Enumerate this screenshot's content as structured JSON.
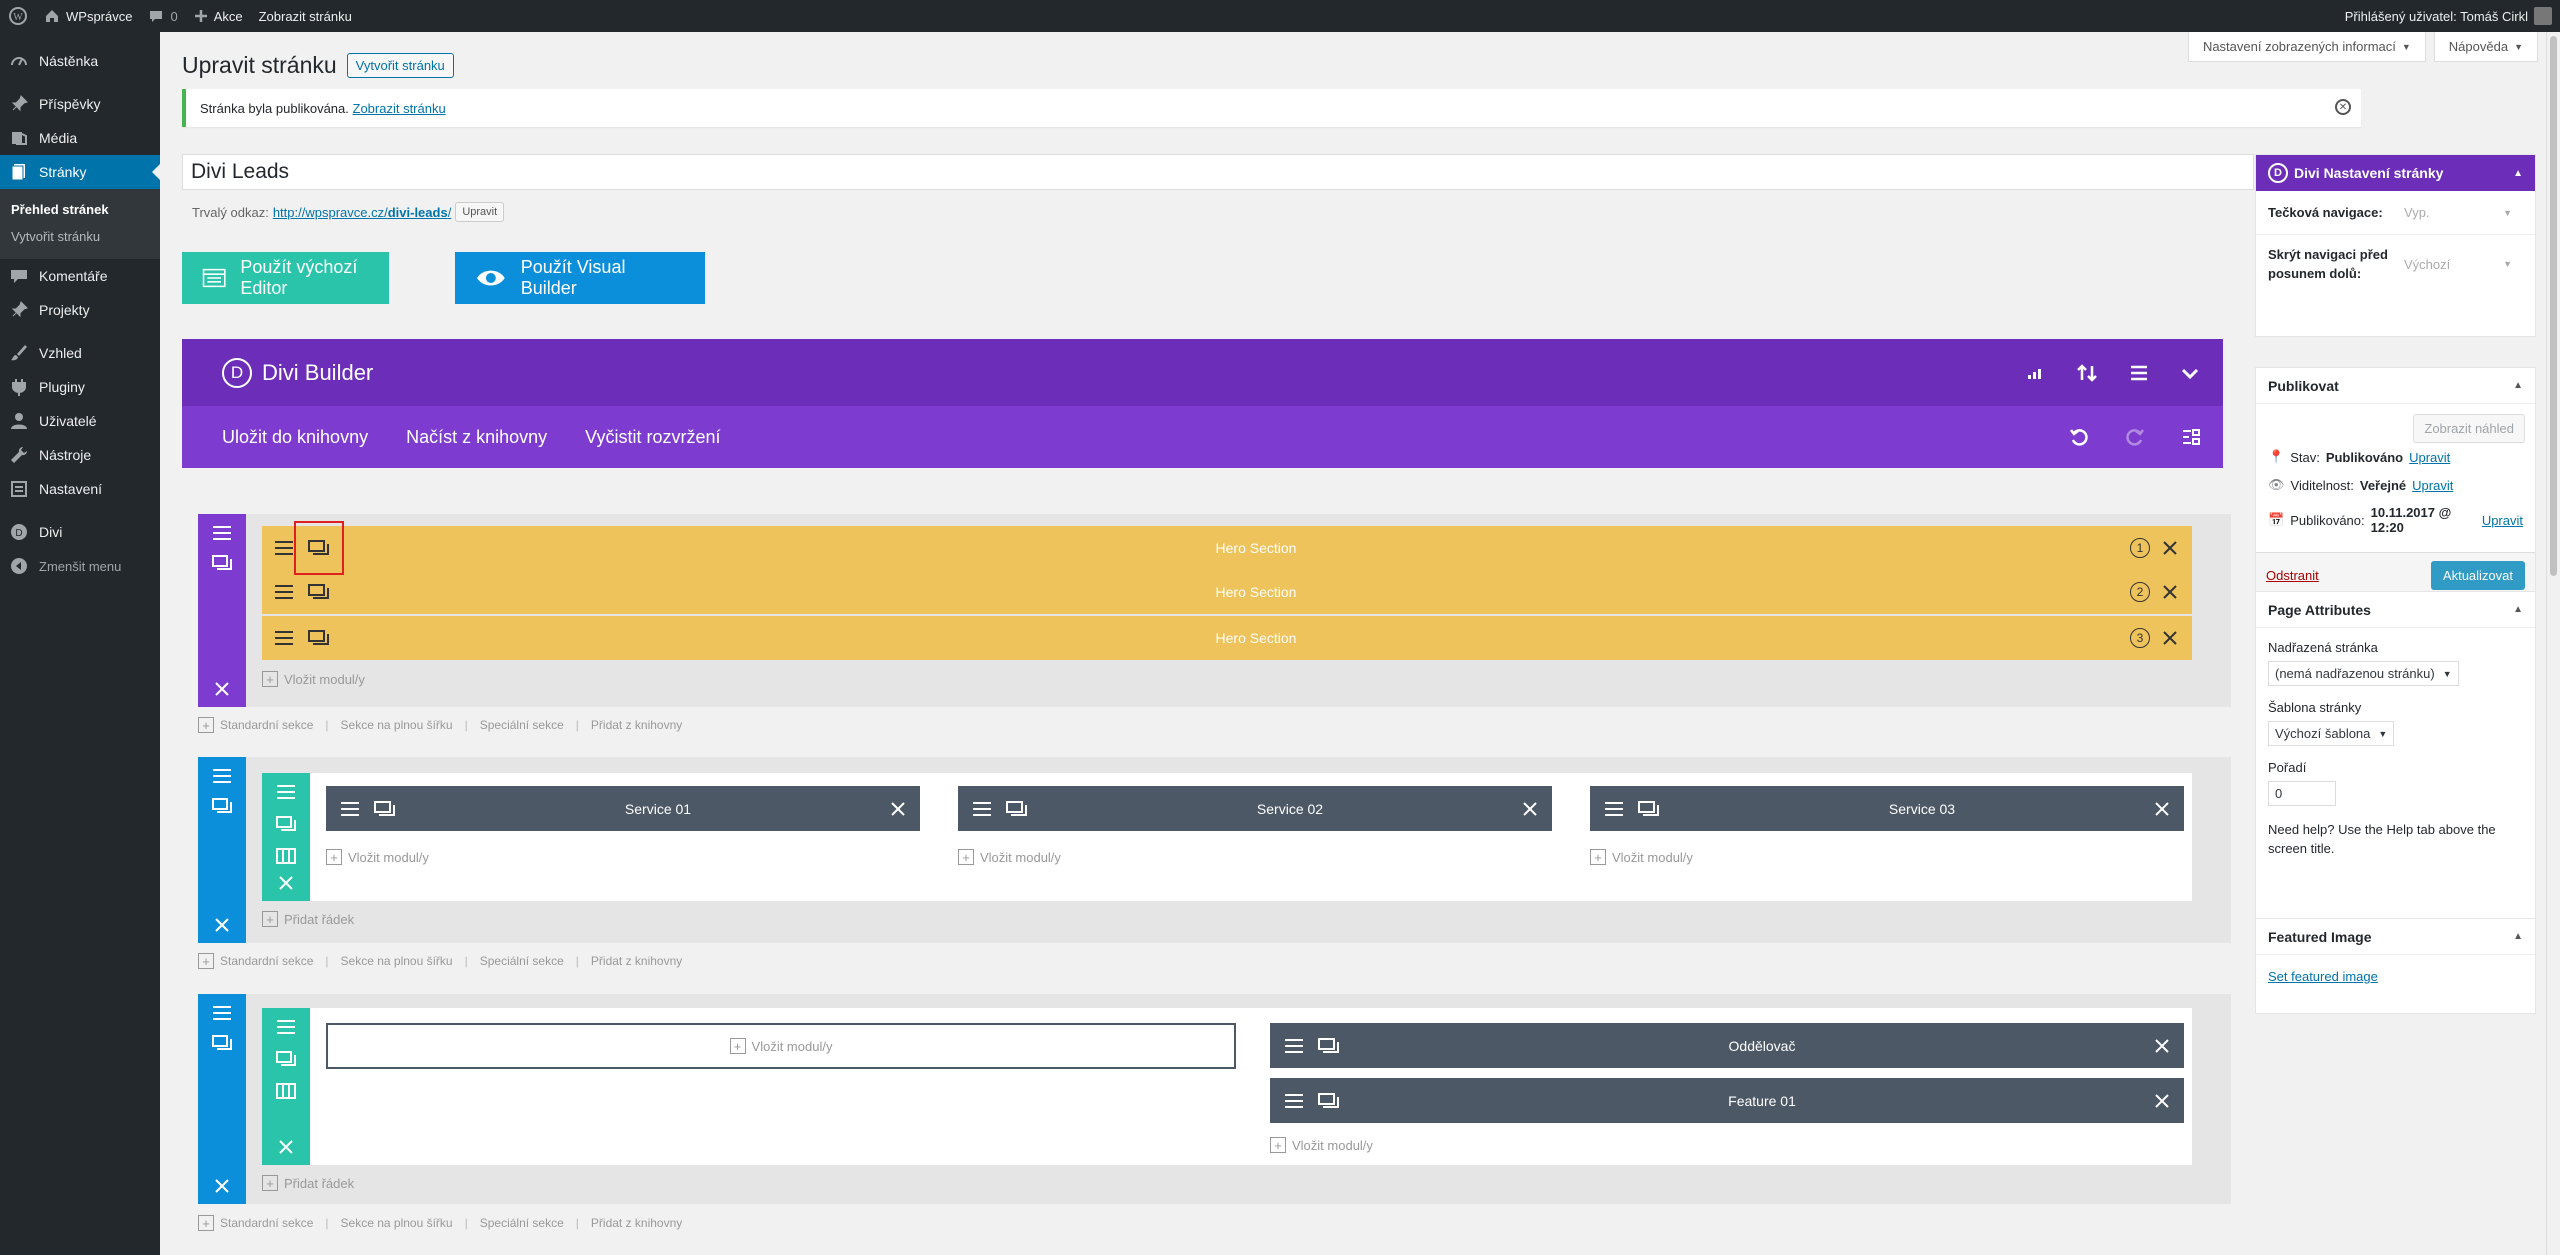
{
  "admin_bar": {
    "site_name": "WPsprávce",
    "comments_count": "0",
    "new_label": "Akce",
    "view_page": "Zobrazit stránku",
    "logged_in": "Přihlášený uživatel: Tomáš Cirkl"
  },
  "menu": {
    "items": [
      {
        "label": "Nástěnka",
        "icon": "dashboard-icon"
      },
      {
        "label": "Příspěvky",
        "icon": "pin-icon"
      },
      {
        "label": "Média",
        "icon": "media-icon"
      },
      {
        "label": "Stránky",
        "icon": "pages-icon"
      },
      {
        "label": "Komentáře",
        "icon": "comment-icon"
      },
      {
        "label": "Projekty",
        "icon": "pin-icon"
      },
      {
        "label": "Vzhled",
        "icon": "brush-icon"
      },
      {
        "label": "Pluginy",
        "icon": "plugin-icon"
      },
      {
        "label": "Uživatelé",
        "icon": "user-icon"
      },
      {
        "label": "Nástroje",
        "icon": "wrench-icon"
      },
      {
        "label": "Nastavení",
        "icon": "settings-icon"
      },
      {
        "label": "Divi",
        "icon": "divi-icon"
      }
    ],
    "sub": [
      "Přehled stránek",
      "Vytvořit stránku"
    ],
    "collapse": "Zmenšit menu"
  },
  "screen_options": "Nastavení zobrazených informací",
  "help": "Nápověda",
  "heading": "Upravit stránku",
  "add_new": "Vytvořit stránku",
  "notice": {
    "text": "Stránka byla publikována.",
    "link": "Zobrazit stránku"
  },
  "post_title": "Divi Leads",
  "permalink": {
    "label": "Trvalý odkaz:",
    "url_base": "http://wpspravce.cz/",
    "slug": "divi-leads",
    "url_end": "/",
    "edit": "Upravit"
  },
  "editor_buttons": {
    "default": "Použít výchozí Editor",
    "visual": "Použít Visual Builder"
  },
  "builder": {
    "title": "Divi Builder",
    "save_library": "Uložit do knihovny",
    "load_library": "Načíst z knihovny",
    "clear_layout": "Vyčistit rozvržení",
    "hero_label": "Hero Section",
    "hero_nums": [
      "1",
      "2",
      "3"
    ],
    "insert_module": "Vložit modul/y",
    "add_row": "Přidat řádek",
    "add_links": [
      "Standardní sekce",
      "Sekce na plnou šířku",
      "Speciální sekce",
      "Přidat z knihovny"
    ],
    "services": [
      "Service 01",
      "Service 02",
      "Service 03"
    ],
    "divider": "Oddělovač",
    "feature": "Feature 01",
    "colors": {
      "purple": "#6c2eb9",
      "blue": "#0c8fdb",
      "teal": "#29c4a9",
      "yellow": "#eec35b",
      "dark": "#4c5866"
    }
  },
  "sidebar": {
    "divi_title": "Divi Nastavení stránky",
    "dot_nav_label": "Tečková navigace:",
    "dot_nav_value": "Vyp.",
    "hide_nav_label": "Skrýt navigaci před posunem dolů:",
    "hide_nav_value": "Výchozí",
    "publish_title": "Publikovat",
    "preview": "Zobrazit náhled",
    "status_label": "Stav:",
    "status_value": "Publikováno",
    "visibility_label": "Viditelnost:",
    "visibility_value": "Veřejné",
    "published_label": "Publikováno:",
    "published_value": "10.11.2017 @ 12:20",
    "edit": "Upravit",
    "trash": "Odstranit",
    "update": "Aktualizovat",
    "attr_title": "Page Attributes",
    "parent_label": "Nadřazená stránka",
    "parent_value": "(nemá nadřazenou stránku)",
    "template_label": "Šablona stránky",
    "template_value": "Výchozí šablona",
    "order_label": "Pořadí",
    "order_value": "0",
    "help_text": "Need help? Use the Help tab above the screen title.",
    "featured_title": "Featured Image",
    "featured_link": "Set featured image"
  }
}
